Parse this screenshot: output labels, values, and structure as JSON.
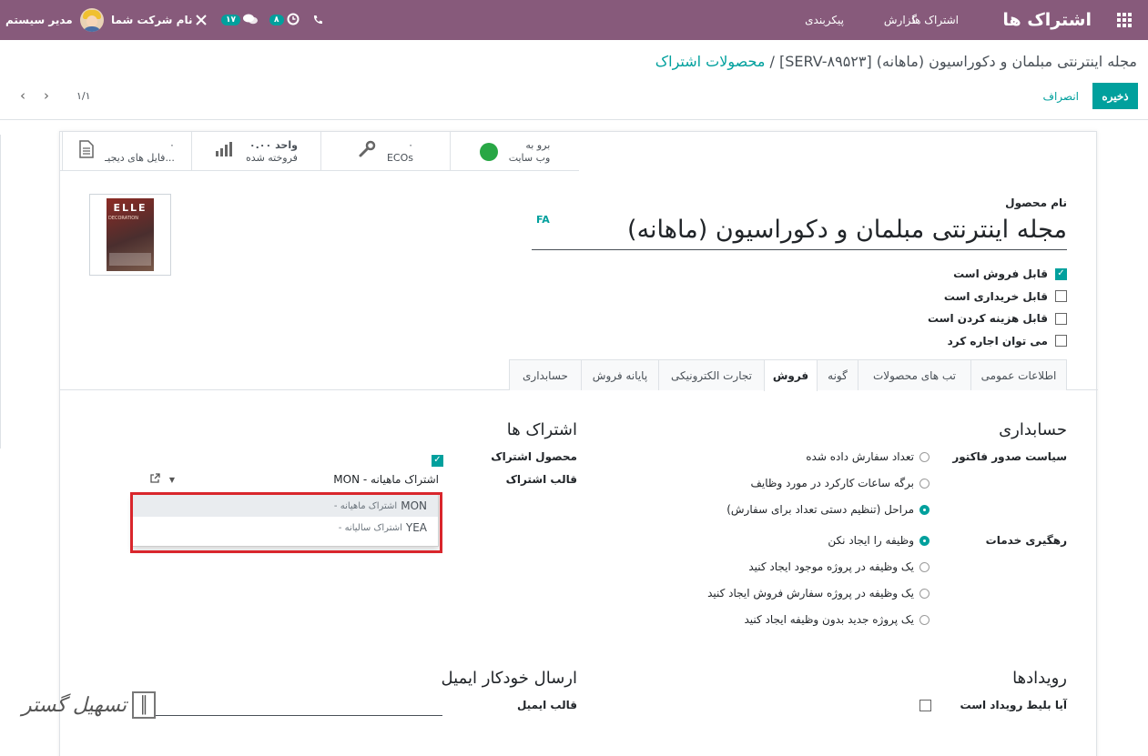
{
  "navbar": {
    "brand": "اشتراک ها",
    "menu": [
      "اشتراک ها",
      "گزارش",
      "پیکربندی"
    ],
    "user": "مدیر سیستم",
    "company": "نام شرکت شما",
    "chat_badge": "۱۷",
    "activity_badge": "۸",
    "colors": {
      "bar": "#875a7b",
      "badge": "#00a09d"
    }
  },
  "breadcrumb": {
    "parent": "محصولات اشتراک",
    "separator": "/",
    "current": "[SERV-۸۹۵۲۳] مجله اینترنتی مبلمان و دکوراسیون (ماهانه)"
  },
  "actions": {
    "save": "ذخیره",
    "discard": "انصراف"
  },
  "pager": {
    "value": "۱/۱"
  },
  "stat_buttons": [
    {
      "icon": "globe-icon",
      "value": "برو به",
      "label": "وب سایت"
    },
    {
      "icon": "wrench-icon",
      "value": "۰",
      "label": "ECOs"
    },
    {
      "icon": "bar-chart-icon",
      "value": "۰.۰۰ واحد",
      "label": "فروخته شده"
    },
    {
      "icon": "file-icon",
      "value": "۰",
      "label": "فایل های دیجیـ..."
    }
  ],
  "product": {
    "name_label": "نام محصول",
    "lang": "FA",
    "name": "مجله اینترنتی مبلمان و دکوراسیون (ماهانه)",
    "image_text": "ELLE",
    "image_subtext": "DECORATION"
  },
  "flags": [
    {
      "label": "قابل فروش است",
      "checked": true
    },
    {
      "label": "قابل خریداری است",
      "checked": false
    },
    {
      "label": "قابل هزینه کردن است",
      "checked": false
    },
    {
      "label": "می توان اجاره کرد",
      "checked": false
    }
  ],
  "tabs": [
    "اطلاعات عمومی",
    "تب های محصولات",
    "گونه",
    "فروش",
    "تجارت الکترونیکی",
    "پایانه فروش",
    "حسابداری"
  ],
  "active_tab": "فروش",
  "accounting": {
    "title": "حسابداری",
    "invoice_policy_label": "سیاست صدور فاکتور",
    "invoice_options": [
      {
        "label": "تعداد سفارش داده شده",
        "selected": false
      },
      {
        "label": "برگه ساعات کارکرد در مورد وظایف",
        "selected": false
      },
      {
        "label": "مراحل (تنظیم دستی تعداد برای سفارش)",
        "selected": true
      }
    ],
    "tracking_label": "رهگیری خدمات",
    "tracking_options": [
      {
        "label": "وظیفه را ایجاد نکن",
        "selected": true
      },
      {
        "label": "یک وظیفه در پروژه موجود ایجاد کنید",
        "selected": false
      },
      {
        "label": "یک وظیفه در پروژه سفارش فروش ایجاد کنید",
        "selected": false
      },
      {
        "label": "یک پروژه جدید بدون وظیفه ایجاد کنید",
        "selected": false
      }
    ]
  },
  "subscriptions": {
    "title": "اشتراک ها",
    "product_label": "محصول اشتراک",
    "product_checked": true,
    "template_label": "قالب اشتراک",
    "template_value": "MON - اشتراک ماهیانه",
    "dropdown": [
      {
        "code": "MON",
        "name": "- اشتراک ماهیانه"
      },
      {
        "code": "YEA",
        "name": "- اشتراک سالیانه"
      }
    ]
  },
  "events": {
    "title": "رویدادها",
    "ticket_label": "آیا بلیط رویداد است",
    "ticket_checked": false
  },
  "email": {
    "title": "ارسال خودکار ایمیل",
    "template_label": "قالب ایمیل",
    "template_value": ""
  },
  "watermark": {
    "text": "تسهیل گستر"
  }
}
